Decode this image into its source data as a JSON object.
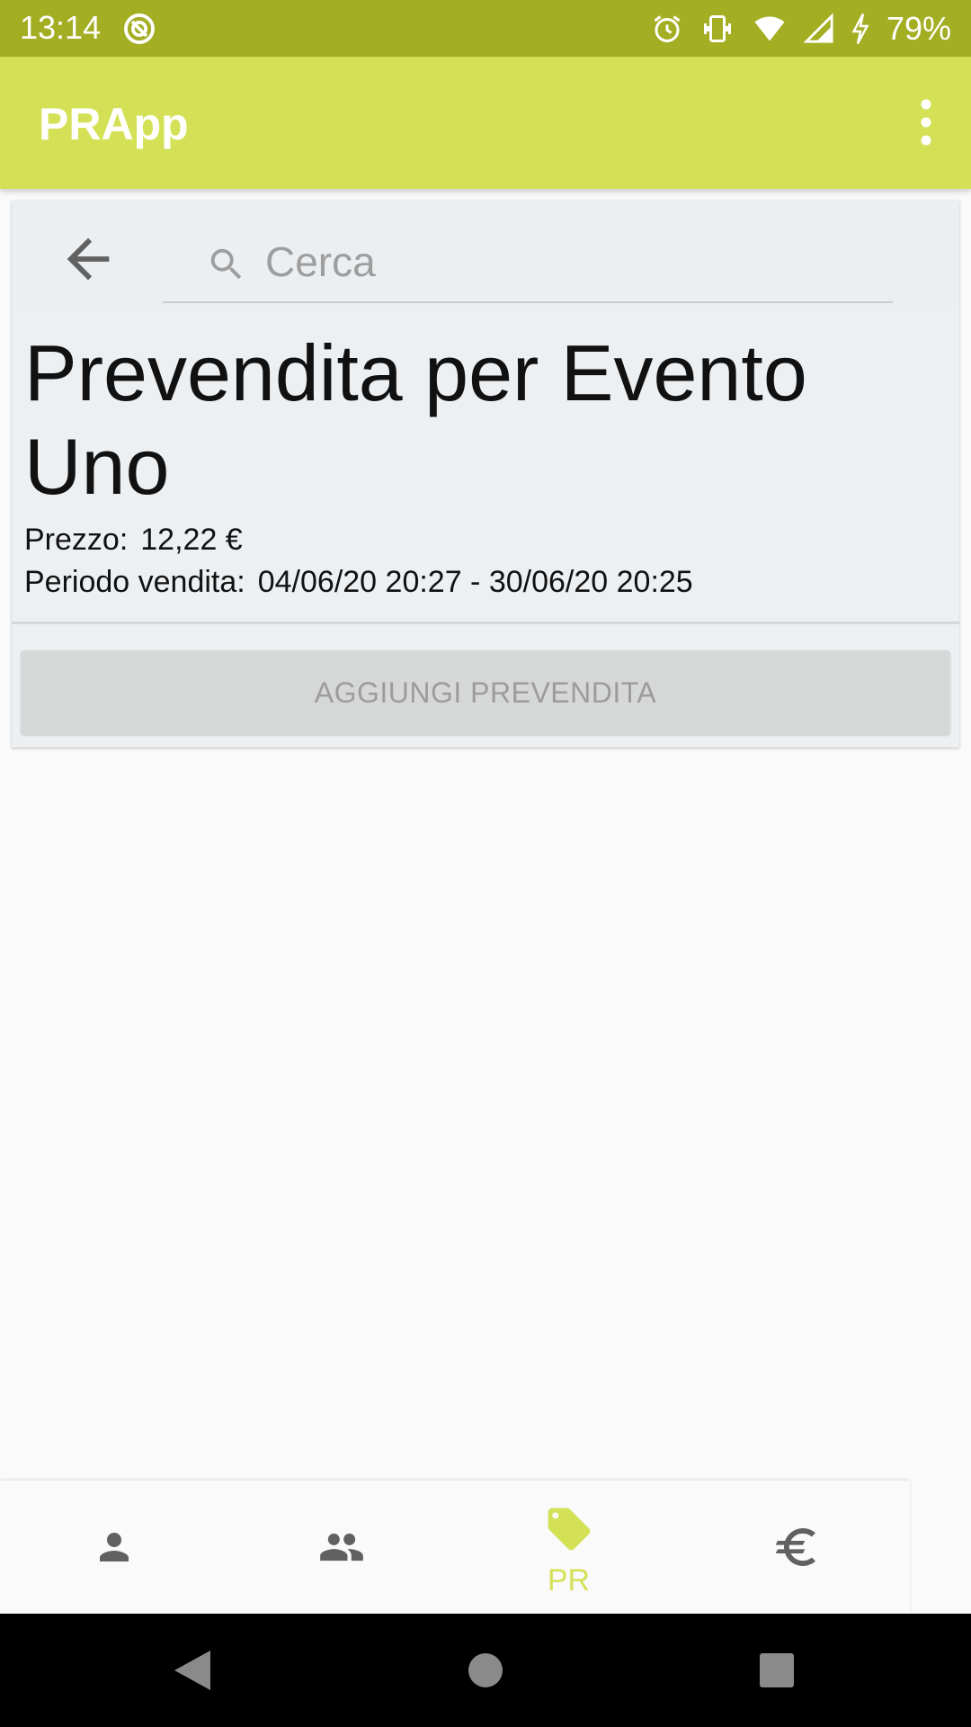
{
  "status_bar": {
    "time": "13:14",
    "battery": "79%",
    "icons": [
      "sync-icon",
      "alarm-icon",
      "vibrate-icon",
      "wifi-icon",
      "signal-icon",
      "charging-icon"
    ]
  },
  "app_bar": {
    "title": "PRApp"
  },
  "search": {
    "placeholder": "Cerca",
    "value": ""
  },
  "event": {
    "title": "Prevendita per Evento Uno",
    "price_label": "Prezzo:",
    "price_value": "12,22 €",
    "period_label": "Periodo vendita:",
    "period_value": "04/06/20 20:27 - 30/06/20 20:25"
  },
  "actions": {
    "add_label": "AGGIUNGI PREVENDITA"
  },
  "bottom_nav": {
    "items": [
      {
        "icon": "person-icon",
        "label": ""
      },
      {
        "icon": "group-icon",
        "label": ""
      },
      {
        "icon": "tag-icon",
        "label": "PR"
      },
      {
        "icon": "euro-icon",
        "label": ""
      }
    ],
    "active_color": "#d4e157",
    "inactive_color": "#616161"
  },
  "colors": {
    "status_bar": "#a4ae23",
    "app_bar": "#d4e157",
    "card": "#edf0f3",
    "button_disabled": "#d6d7d7"
  }
}
